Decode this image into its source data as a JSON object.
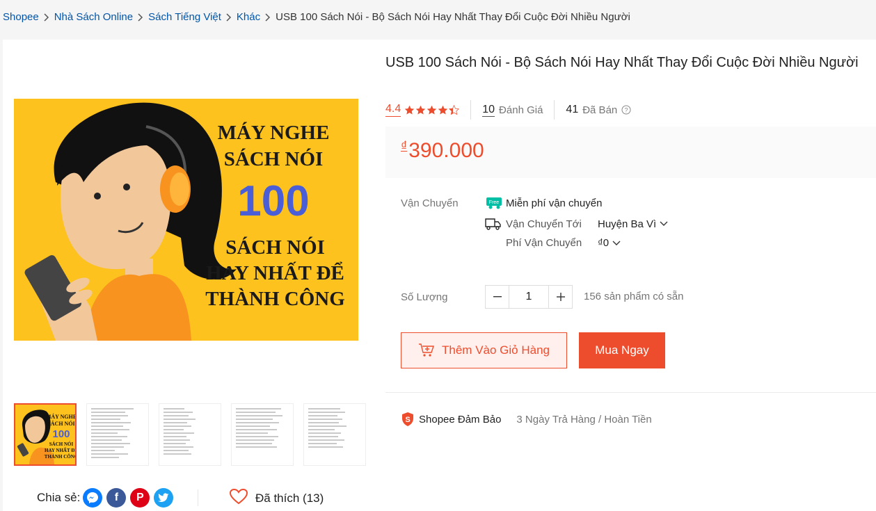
{
  "breadcrumb": {
    "items": [
      "Shopee",
      "Nhà Sách Online",
      "Sách Tiếng Việt",
      "Khác"
    ],
    "current": "USB 100 Sách Nói - Bộ Sách Nói Hay Nhất Thay Đổi Cuộc Đời Nhiều Người"
  },
  "gallery": {
    "poster_lines": {
      "line1": "MÁY NGHE",
      "line2": "SÁCH NÓI",
      "number": "100",
      "line3": "SÁCH NÓI",
      "line4": "HAY NHẤT ĐỂ",
      "line5": "THÀNH CÔNG"
    },
    "thumbnail_count": 5,
    "active_thumbnail": 1
  },
  "share": {
    "label": "Chia sẻ:",
    "icons": [
      "messenger-icon",
      "facebook-icon",
      "pinterest-icon",
      "twitter-icon"
    ]
  },
  "like": {
    "label": "Đã thích (13)"
  },
  "product": {
    "title": "USB 100 Sách Nói - Bộ Sách Nói Hay Nhất Thay Đổi Cuộc Đời Nhiều Người",
    "rating": "4.4",
    "rating_value": 4.4,
    "reviews_count": "10",
    "reviews_label": "Đánh Giá",
    "sold_count": "41",
    "sold_label": "Đã Bán",
    "price_currency": "₫",
    "price": "390.000"
  },
  "shipping": {
    "label": "Vận Chuyển",
    "free_badge": "Free",
    "free_text": "Miễn phí vận chuyển",
    "to_label": "Vận Chuyển Tới",
    "to_value": "Huyện Ba Vì",
    "fee_label": "Phí Vận Chuyển",
    "fee_value": "₫0"
  },
  "quantity": {
    "label": "Số Lượng",
    "value": "1",
    "stock_text": "156 sản phẩm có sẵn"
  },
  "actions": {
    "add_to_cart": "Thêm Vào Giỏ Hàng",
    "buy_now": "Mua Ngay"
  },
  "guarantee": {
    "title": "Shopee Đảm Bảo",
    "description": "3 Ngày Trả Hàng / Hoàn Tiền"
  },
  "colors": {
    "accent": "#ee4d2d",
    "link": "#0055aa",
    "poster_bg": "#fec21e",
    "poster_number": "#4a5ed8"
  }
}
